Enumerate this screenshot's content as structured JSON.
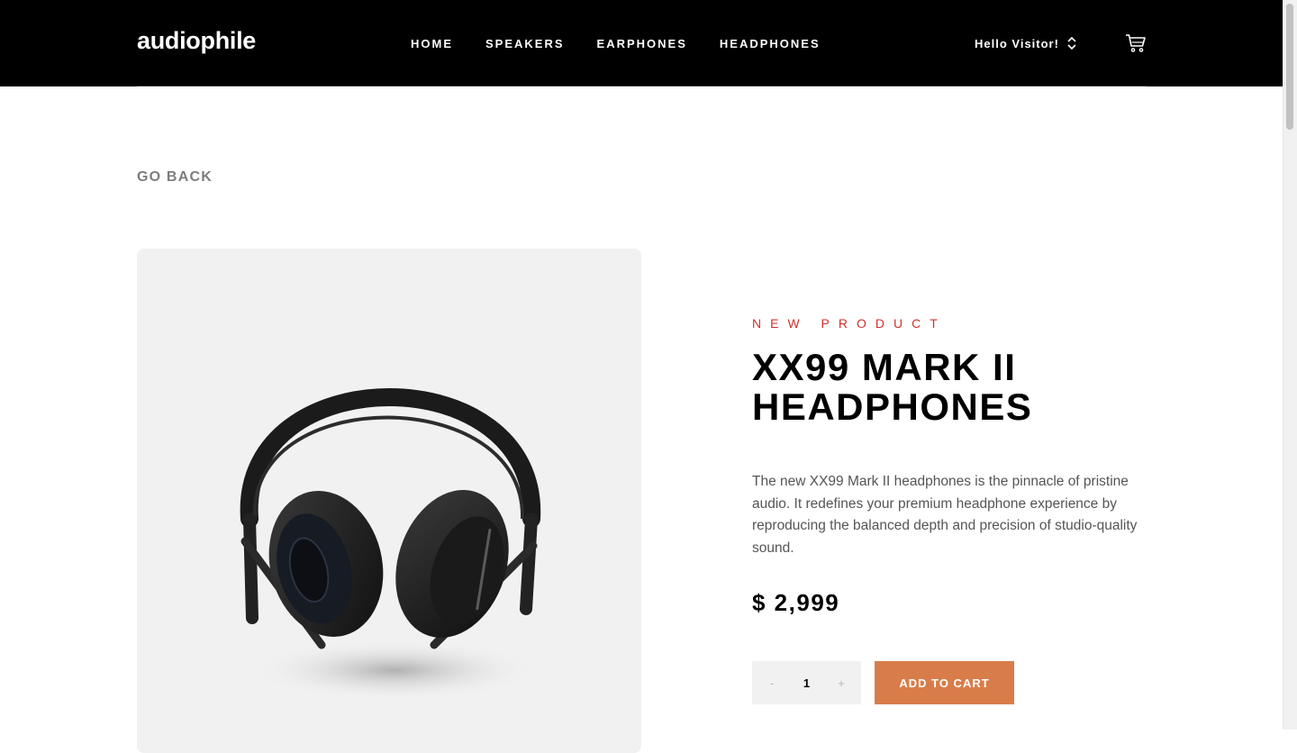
{
  "header": {
    "logo": "audiophile",
    "nav": [
      "HOME",
      "SPEAKERS",
      "EARPHONES",
      "HEADPHONES"
    ],
    "greeting": "Hello Visitor!",
    "icons": {
      "greeting_toggle": "chevron-up-down-icon",
      "cart": "cart-icon"
    }
  },
  "page": {
    "go_back": "GO BACK"
  },
  "product": {
    "overline": "NEW PRODUCT",
    "title_line1": "XX99 MARK II",
    "title_line2": "HEADPHONES",
    "description": "The new XX99 Mark II headphones is the pinnacle of pristine audio. It redefines your premium headphone experience by reproducing the balanced depth and precision of studio-quality sound.",
    "price": "$ 2,999",
    "quantity": "1",
    "decrement": "-",
    "increment": "+",
    "add_to_cart": "ADD TO CART",
    "image_alt": "headphones-image"
  },
  "colors": {
    "header_bg": "#000000",
    "accent": "#d87d4a",
    "overline": "#d0312d",
    "image_bg": "#f1f1f1"
  }
}
